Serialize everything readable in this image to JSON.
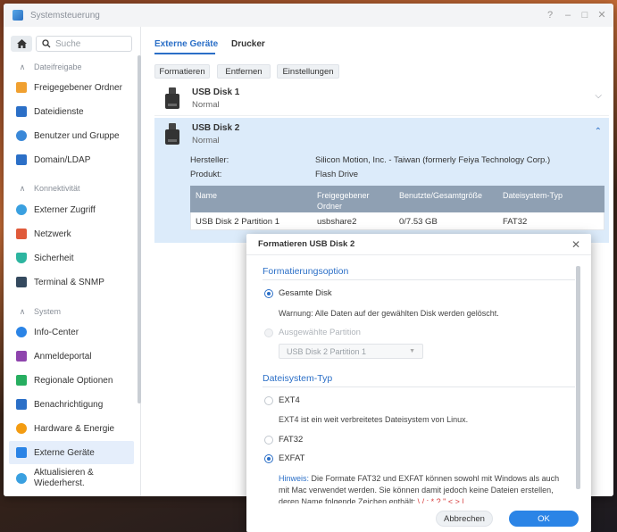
{
  "window": {
    "title": "Systemsteuerung"
  },
  "titlebar": {
    "help": "?",
    "minimize": "–",
    "maximize": "□",
    "close": "✕"
  },
  "sidebar": {
    "search_placeholder": "Suche",
    "sections": [
      {
        "label": "Dateifreigabe",
        "items": [
          {
            "label": "Freigegebener Ordner",
            "icon": "folder-icon",
            "color": "#f0a030"
          },
          {
            "label": "Dateidienste",
            "icon": "file-services-icon",
            "color": "#2b6fc7"
          },
          {
            "label": "Benutzer und Gruppe",
            "icon": "users-icon",
            "color": "#3a88d8"
          },
          {
            "label": "Domain/LDAP",
            "icon": "domain-icon",
            "color": "#2b6fc7"
          }
        ]
      },
      {
        "label": "Konnektivität",
        "items": [
          {
            "label": "Externer Zugriff",
            "icon": "globe-icon",
            "color": "#3aa0e0"
          },
          {
            "label": "Netzwerk",
            "icon": "home-network-icon",
            "color": "#e05a3a"
          },
          {
            "label": "Sicherheit",
            "icon": "shield-icon",
            "color": "#2db5a0"
          },
          {
            "label": "Terminal & SNMP",
            "icon": "terminal-icon",
            "color": "#34495e"
          }
        ]
      },
      {
        "label": "System",
        "items": [
          {
            "label": "Info-Center",
            "icon": "info-icon",
            "color": "#2b84e6"
          },
          {
            "label": "Anmeldeportal",
            "icon": "portal-icon",
            "color": "#8e44ad"
          },
          {
            "label": "Regionale Optionen",
            "icon": "region-icon",
            "color": "#27ae60"
          },
          {
            "label": "Benachrichtigung",
            "icon": "notification-icon",
            "color": "#2b6fc7"
          },
          {
            "label": "Hardware & Energie",
            "icon": "bulb-icon",
            "color": "#f39c12"
          },
          {
            "label": "Externe Geräte",
            "icon": "external-devices-icon",
            "color": "#2b84e6"
          },
          {
            "label": "Aktualisieren & Wiederherst.",
            "icon": "update-icon",
            "color": "#3aa0e0"
          }
        ]
      }
    ]
  },
  "main": {
    "tabs": [
      "Externe Geräte",
      "Drucker"
    ],
    "toolbar": {
      "format": "Formatieren",
      "eject": "Entfernen",
      "settings": "Einstellungen"
    },
    "disk1": {
      "name": "USB Disk 1",
      "status": "Normal"
    },
    "disk2": {
      "name": "USB Disk 2",
      "status": "Normal",
      "manufacturer_label": "Hersteller:",
      "manufacturer": "Silicon Motion, Inc. - Taiwan (formerly Feiya Technology Corp.)",
      "product_label": "Produkt:",
      "product": "Flash Drive",
      "table": {
        "headers": [
          "Name",
          "Freigegebener Ordner",
          "Benutzte/Gesamtgröße",
          "Dateisystem-Typ"
        ],
        "row": [
          "USB Disk 2 Partition 1",
          "usbshare2",
          "0/7.53 GB",
          "FAT32"
        ]
      }
    }
  },
  "dialog": {
    "title": "Formatieren USB Disk 2",
    "section1": "Formatierungsoption",
    "opt_whole": "Gesamte Disk",
    "warning": "Warnung: Alle Daten auf der gewählten Disk werden gelöscht.",
    "opt_partition": "Ausgewählte Partition",
    "partition_value": "USB Disk 2 Partition 1",
    "section2": "Dateisystem-Typ",
    "fs_ext4": "EXT4",
    "ext4_desc": "EXT4 ist ein weit verbreitetes Dateisystem von Linux.",
    "fs_fat32": "FAT32",
    "fs_exfat": "EXFAT",
    "hint_keyword": "Hinweis:",
    "hint_line1": " Die Formate FAT32 und EXFAT können sowohl mit Windows als auch",
    "hint_line2": "mit Mac verwendet werden. Sie können damit jedoch keine Dateien erstellen,",
    "hint_line3": "deren Name folgende Zeichen enthält: ",
    "hint_chars": "\\ / : * ? \" < > | .",
    "cancel": "Abbrechen",
    "ok": "OK"
  }
}
